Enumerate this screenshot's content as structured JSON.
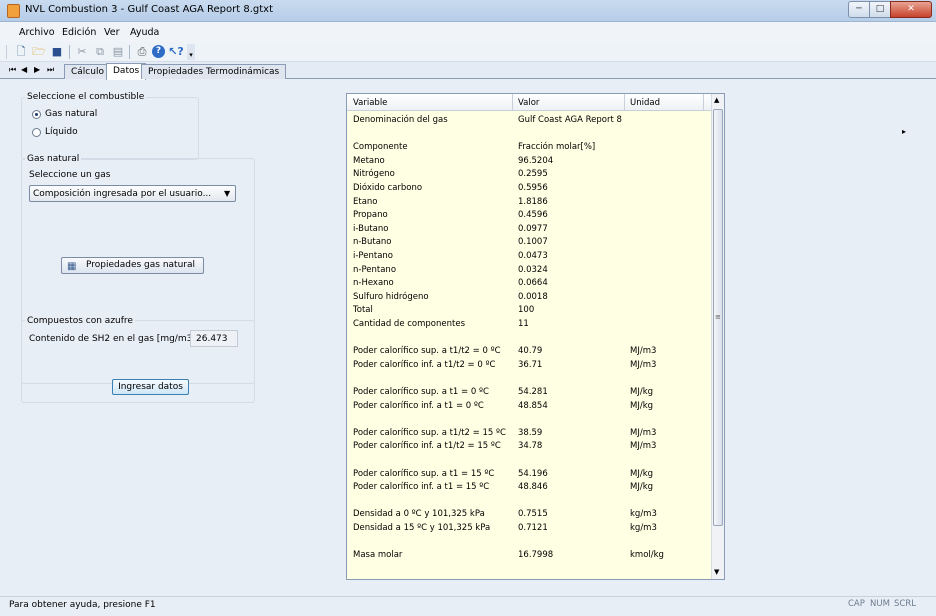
{
  "window": {
    "title": "NVL Combustion 3 - Gulf Coast AGA Report 8.gtxt",
    "min": "─",
    "max": "□",
    "close": "✕"
  },
  "menu": [
    "Archivo",
    "Edición",
    "Ver",
    "Ayuda"
  ],
  "toolbar_icons": [
    "new-icon",
    "open-icon",
    "save-icon",
    "cut-icon",
    "copy-icon",
    "paste-icon",
    "print-icon",
    "help-icon",
    "context-help-icon"
  ],
  "tabs": {
    "nav": [
      "⏮",
      "◀",
      "▶",
      "⏭"
    ],
    "items": [
      "Cálculo",
      "Datos",
      "Propiedades Termodinámicas"
    ],
    "active": 1
  },
  "fuel": {
    "title": "Seleccione el combustible",
    "options": [
      "Gas natural",
      "Líquido"
    ],
    "selected": 0
  },
  "gas": {
    "title": "Gas natural",
    "select_label": "Seleccione un gas",
    "combo_value": "Composición ingresada por el usuario...",
    "props_button": "Propiedades gas natural"
  },
  "sulfur": {
    "title": "Compuestos con azufre",
    "label": "Contenido de SH2 en el gas [mg/m3]",
    "value": "26.473",
    "button": "Ingresar datos"
  },
  "results": {
    "headers": [
      "Variable",
      "Valor",
      "Unidad"
    ],
    "rows": [
      [
        "Denominación del gas",
        "Gulf Coast AGA Report 8",
        ""
      ],
      [
        "",
        "",
        ""
      ],
      [
        "Componente",
        "Fracción molar[%]",
        ""
      ],
      [
        "Metano",
        "96.5204",
        ""
      ],
      [
        "Nitrógeno",
        "0.2595",
        ""
      ],
      [
        "Dióxido carbono",
        "0.5956",
        ""
      ],
      [
        "Etano",
        "1.8186",
        ""
      ],
      [
        "Propano",
        "0.4596",
        ""
      ],
      [
        "i-Butano",
        "0.0977",
        ""
      ],
      [
        "n-Butano",
        "0.1007",
        ""
      ],
      [
        "i-Pentano",
        "0.0473",
        ""
      ],
      [
        "n-Pentano",
        "0.0324",
        ""
      ],
      [
        "n-Hexano",
        "0.0664",
        ""
      ],
      [
        "Sulfuro hidrógeno",
        "0.0018",
        ""
      ],
      [
        "Total",
        "100",
        ""
      ],
      [
        "Cantidad de componentes",
        "11",
        ""
      ],
      [
        "",
        "",
        ""
      ],
      [
        "Poder calorífico sup. a t1/t2 = 0 ºC",
        "40.79",
        "MJ/m3"
      ],
      [
        "Poder calorífico inf. a t1/t2 = 0 ºC",
        "36.71",
        "MJ/m3"
      ],
      [
        "",
        "",
        ""
      ],
      [
        "Poder calorífico sup. a t1 = 0 ºC",
        "54.281",
        "MJ/kg"
      ],
      [
        "Poder calorífico inf. a t1 = 0 ºC",
        "48.854",
        "MJ/kg"
      ],
      [
        "",
        "",
        ""
      ],
      [
        "Poder calorífico sup. a t1/t2 = 15 ºC",
        "38.59",
        "MJ/m3"
      ],
      [
        "Poder calorífico inf. a t1/t2 = 15 ºC",
        "34.78",
        "MJ/m3"
      ],
      [
        "",
        "",
        ""
      ],
      [
        "Poder calorífico sup. a t1 = 15 ºC",
        "54.196",
        "MJ/kg"
      ],
      [
        "Poder calorífico inf. a t1 = 15 ºC",
        "48.846",
        "MJ/kg"
      ],
      [
        "",
        "",
        ""
      ],
      [
        "Densidad a 0 ºC y 101,325 kPa",
        "0.7515",
        "kg/m3"
      ],
      [
        "Densidad a 15 ºC y 101,325 kPa",
        "0.7121",
        "kg/m3"
      ],
      [
        "",
        "",
        ""
      ],
      [
        "Masa molar",
        "16.7998",
        "kmol/kg"
      ]
    ]
  },
  "status": {
    "text": "Para obtener ayuda, presione F1",
    "indicators": [
      "CAP",
      "NUM",
      "SCRL"
    ]
  }
}
